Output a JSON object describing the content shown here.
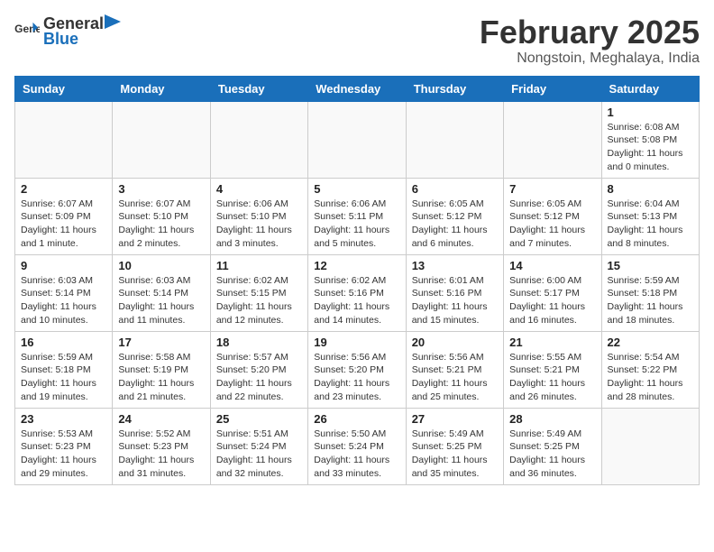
{
  "header": {
    "logo_general": "General",
    "logo_blue": "Blue",
    "month_title": "February 2025",
    "location": "Nongstoin, Meghalaya, India"
  },
  "days_of_week": [
    "Sunday",
    "Monday",
    "Tuesday",
    "Wednesday",
    "Thursday",
    "Friday",
    "Saturday"
  ],
  "weeks": [
    [
      {
        "day": "",
        "info": ""
      },
      {
        "day": "",
        "info": ""
      },
      {
        "day": "",
        "info": ""
      },
      {
        "day": "",
        "info": ""
      },
      {
        "day": "",
        "info": ""
      },
      {
        "day": "",
        "info": ""
      },
      {
        "day": "1",
        "info": "Sunrise: 6:08 AM\nSunset: 5:08 PM\nDaylight: 11 hours\nand 0 minutes."
      }
    ],
    [
      {
        "day": "2",
        "info": "Sunrise: 6:07 AM\nSunset: 5:09 PM\nDaylight: 11 hours\nand 1 minute."
      },
      {
        "day": "3",
        "info": "Sunrise: 6:07 AM\nSunset: 5:10 PM\nDaylight: 11 hours\nand 2 minutes."
      },
      {
        "day": "4",
        "info": "Sunrise: 6:06 AM\nSunset: 5:10 PM\nDaylight: 11 hours\nand 3 minutes."
      },
      {
        "day": "5",
        "info": "Sunrise: 6:06 AM\nSunset: 5:11 PM\nDaylight: 11 hours\nand 5 minutes."
      },
      {
        "day": "6",
        "info": "Sunrise: 6:05 AM\nSunset: 5:12 PM\nDaylight: 11 hours\nand 6 minutes."
      },
      {
        "day": "7",
        "info": "Sunrise: 6:05 AM\nSunset: 5:12 PM\nDaylight: 11 hours\nand 7 minutes."
      },
      {
        "day": "8",
        "info": "Sunrise: 6:04 AM\nSunset: 5:13 PM\nDaylight: 11 hours\nand 8 minutes."
      }
    ],
    [
      {
        "day": "9",
        "info": "Sunrise: 6:03 AM\nSunset: 5:14 PM\nDaylight: 11 hours\nand 10 minutes."
      },
      {
        "day": "10",
        "info": "Sunrise: 6:03 AM\nSunset: 5:14 PM\nDaylight: 11 hours\nand 11 minutes."
      },
      {
        "day": "11",
        "info": "Sunrise: 6:02 AM\nSunset: 5:15 PM\nDaylight: 11 hours\nand 12 minutes."
      },
      {
        "day": "12",
        "info": "Sunrise: 6:02 AM\nSunset: 5:16 PM\nDaylight: 11 hours\nand 14 minutes."
      },
      {
        "day": "13",
        "info": "Sunrise: 6:01 AM\nSunset: 5:16 PM\nDaylight: 11 hours\nand 15 minutes."
      },
      {
        "day": "14",
        "info": "Sunrise: 6:00 AM\nSunset: 5:17 PM\nDaylight: 11 hours\nand 16 minutes."
      },
      {
        "day": "15",
        "info": "Sunrise: 5:59 AM\nSunset: 5:18 PM\nDaylight: 11 hours\nand 18 minutes."
      }
    ],
    [
      {
        "day": "16",
        "info": "Sunrise: 5:59 AM\nSunset: 5:18 PM\nDaylight: 11 hours\nand 19 minutes."
      },
      {
        "day": "17",
        "info": "Sunrise: 5:58 AM\nSunset: 5:19 PM\nDaylight: 11 hours\nand 21 minutes."
      },
      {
        "day": "18",
        "info": "Sunrise: 5:57 AM\nSunset: 5:20 PM\nDaylight: 11 hours\nand 22 minutes."
      },
      {
        "day": "19",
        "info": "Sunrise: 5:56 AM\nSunset: 5:20 PM\nDaylight: 11 hours\nand 23 minutes."
      },
      {
        "day": "20",
        "info": "Sunrise: 5:56 AM\nSunset: 5:21 PM\nDaylight: 11 hours\nand 25 minutes."
      },
      {
        "day": "21",
        "info": "Sunrise: 5:55 AM\nSunset: 5:21 PM\nDaylight: 11 hours\nand 26 minutes."
      },
      {
        "day": "22",
        "info": "Sunrise: 5:54 AM\nSunset: 5:22 PM\nDaylight: 11 hours\nand 28 minutes."
      }
    ],
    [
      {
        "day": "23",
        "info": "Sunrise: 5:53 AM\nSunset: 5:23 PM\nDaylight: 11 hours\nand 29 minutes."
      },
      {
        "day": "24",
        "info": "Sunrise: 5:52 AM\nSunset: 5:23 PM\nDaylight: 11 hours\nand 31 minutes."
      },
      {
        "day": "25",
        "info": "Sunrise: 5:51 AM\nSunset: 5:24 PM\nDaylight: 11 hours\nand 32 minutes."
      },
      {
        "day": "26",
        "info": "Sunrise: 5:50 AM\nSunset: 5:24 PM\nDaylight: 11 hours\nand 33 minutes."
      },
      {
        "day": "27",
        "info": "Sunrise: 5:49 AM\nSunset: 5:25 PM\nDaylight: 11 hours\nand 35 minutes."
      },
      {
        "day": "28",
        "info": "Sunrise: 5:49 AM\nSunset: 5:25 PM\nDaylight: 11 hours\nand 36 minutes."
      },
      {
        "day": "",
        "info": ""
      }
    ]
  ]
}
